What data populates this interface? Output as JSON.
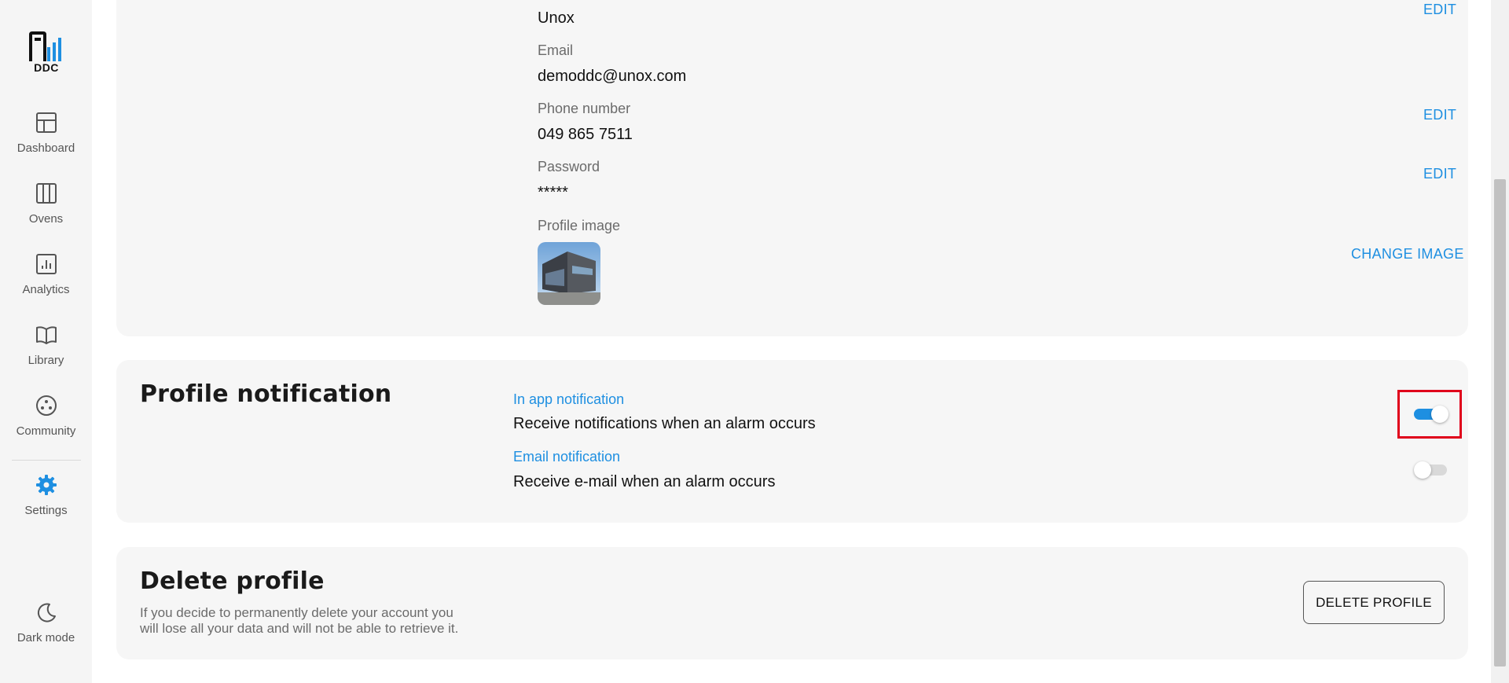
{
  "sidebar": {
    "logo_text": "DDC",
    "items": [
      {
        "label": "Dashboard",
        "icon": "dashboard-icon"
      },
      {
        "label": "Ovens",
        "icon": "ovens-icon"
      },
      {
        "label": "Analytics",
        "icon": "analytics-icon"
      },
      {
        "label": "Library",
        "icon": "library-icon"
      },
      {
        "label": "Community",
        "icon": "community-icon"
      },
      {
        "label": "Settings",
        "icon": "gear-icon",
        "active": true
      }
    ],
    "dark_mode_label": "Dark mode"
  },
  "profile": {
    "name_value": "Unox",
    "name_edit": "EDIT",
    "email_label": "Email",
    "email_value": "demoddc@unox.com",
    "phone_label": "Phone number",
    "phone_value": "049 865 7511",
    "phone_edit": "EDIT",
    "password_label": "Password",
    "password_value": "*****",
    "password_edit": "EDIT",
    "image_label": "Profile image",
    "change_image": "CHANGE IMAGE"
  },
  "notifications": {
    "title": "Profile notification",
    "in_app_label": "In app notification",
    "in_app_desc": "Receive notifications when an alarm occurs",
    "in_app_enabled": true,
    "email_label": "Email notification",
    "email_desc": "Receive e-mail when an alarm occurs",
    "email_enabled": false
  },
  "delete": {
    "title": "Delete profile",
    "desc_line1": "If you decide to permanently delete your account you",
    "desc_line2": "will lose all your data and will not be able to retrieve it.",
    "button_label": "DELETE PROFILE"
  },
  "colors": {
    "accent": "#1e8fe1",
    "highlight": "#e0001b",
    "card_bg": "#f6f6f6",
    "sidebar_bg": "#f5f5f5"
  }
}
